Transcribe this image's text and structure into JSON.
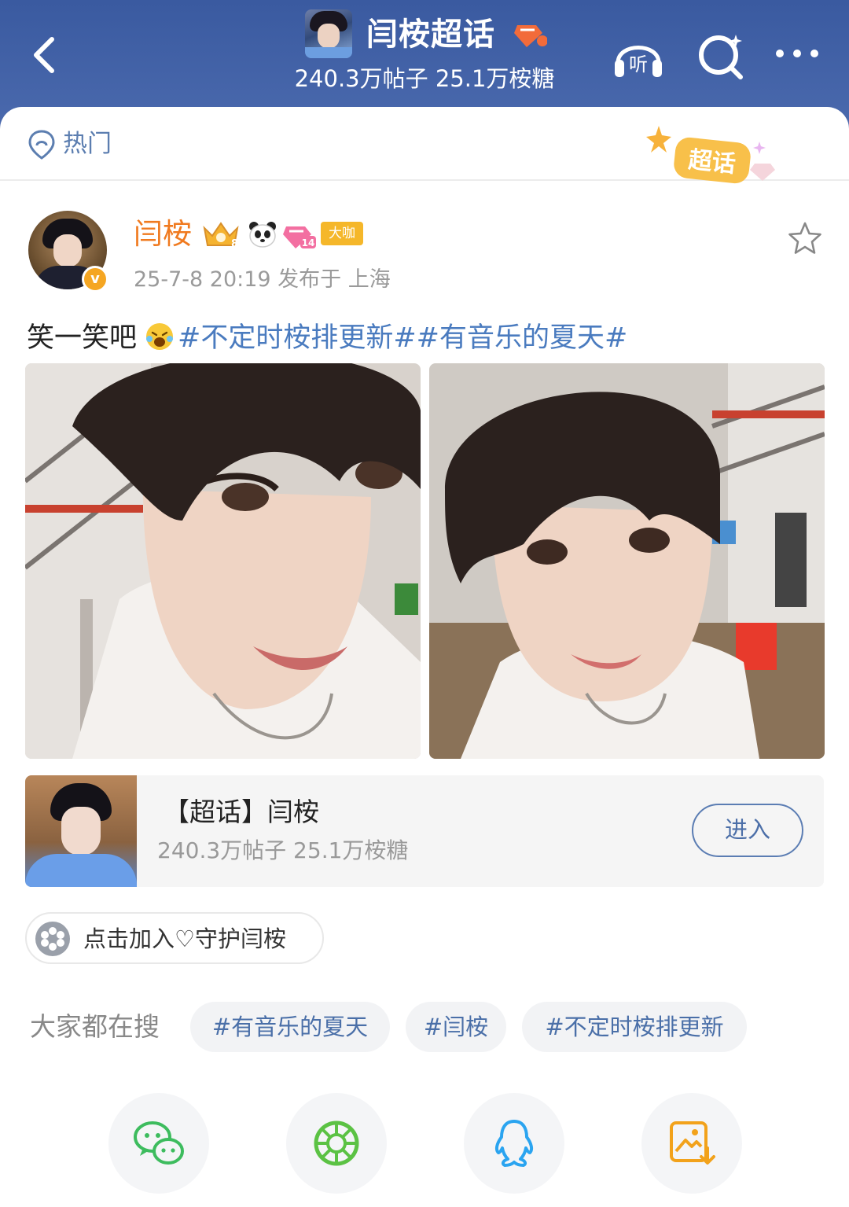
{
  "header": {
    "title": "闫桉超话",
    "stats": "240.3万帖子 25.1万桉糖",
    "listen_label": "听"
  },
  "tabs": {
    "hot_label": "热门",
    "badge_label": "超话"
  },
  "post": {
    "author": "闫桉",
    "badge_daka": "大咖",
    "badge_diamond_level": "14",
    "badge_crown_level": "8",
    "meta": "25-7-8 20:19  发布于 上海",
    "text_plain": "笑一笑吧",
    "text_tags": "#不定时桉排更新##有音乐的夏天#"
  },
  "topic": {
    "title": "【超话】闫桉",
    "stats": "240.3万帖子 25.1万桉糖",
    "enter_label": "进入"
  },
  "join": {
    "label": "点击加入♡守护闫桉"
  },
  "search": {
    "label": "大家都在搜",
    "chips": [
      "#有音乐的夏天",
      "#闫桉",
      "#不定时桉排更新"
    ]
  },
  "share": {
    "icons": [
      "wechat-icon",
      "moments-icon",
      "qq-icon",
      "save-image-icon"
    ]
  },
  "colors": {
    "header_bg": "#3a5aa0",
    "username": "#f07a1f",
    "tag_link": "#4a7bbf",
    "muted": "#9a9a9a"
  }
}
